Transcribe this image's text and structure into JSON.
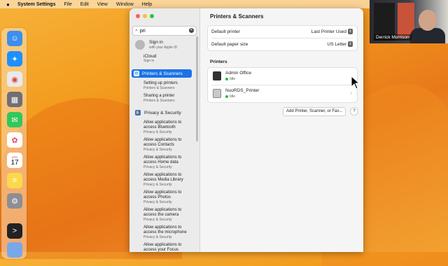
{
  "menubar": {
    "apple": "",
    "app_name": "System Settings",
    "items": [
      "File",
      "Edit",
      "View",
      "Window",
      "Help"
    ]
  },
  "dock": {
    "apps": [
      "finder-icon",
      "safari-icon",
      "chrome-icon",
      "launchpad-icon",
      "messages-icon",
      "photos-icon",
      "calendar-icon",
      "notes-icon",
      "system-settings-icon",
      "terminal-icon"
    ],
    "calendar": {
      "month": "APR",
      "day": "17"
    }
  },
  "webcam": {
    "name": "Derrick Morrison"
  },
  "sidebar": {
    "search": {
      "value": "pri"
    },
    "account": {
      "name": "Sign in",
      "subtitle": "with your Apple ID"
    },
    "icloud": {
      "label": "iCloud",
      "sub": "Sign in"
    },
    "selected": {
      "label": "Printers & Scanners"
    },
    "results": [
      {
        "title": "Setting up printers",
        "sub": "Printers & Scanners"
      },
      {
        "title": "Sharing a printer",
        "sub": "Printers & Scanners"
      }
    ],
    "privacy": {
      "label": "Privacy & Security"
    },
    "privacy_results": [
      {
        "title": "Allow applications to access Bluetooth",
        "sub": "Privacy & Security"
      },
      {
        "title": "Allow applications to access Contacts",
        "sub": "Privacy & Security"
      },
      {
        "title": "Allow applications to access Home data",
        "sub": "Privacy & Security"
      },
      {
        "title": "Allow applications to access Media Library",
        "sub": "Privacy & Security"
      },
      {
        "title": "Allow applications to access Photos",
        "sub": "Privacy & Security"
      },
      {
        "title": "Allow applications to access the camera",
        "sub": "Privacy & Security"
      },
      {
        "title": "Allow applications to access the microphone",
        "sub": "Privacy & Security"
      },
      {
        "title": "Allow applications to access your Focus",
        "sub": ""
      }
    ]
  },
  "main": {
    "title": "Printers & Scanners",
    "settings": [
      {
        "label": "Default printer",
        "value": "Last Printer Used"
      },
      {
        "label": "Default paper size",
        "value": "US Letter"
      }
    ],
    "printers_header": "Printers",
    "printers": [
      {
        "name": "Admin Office",
        "status": "Idle"
      },
      {
        "name": "NuoRDS_Printer",
        "status": "Idle"
      }
    ],
    "add_button": "Add Printer, Scanner, or Fax...",
    "help": "?"
  }
}
